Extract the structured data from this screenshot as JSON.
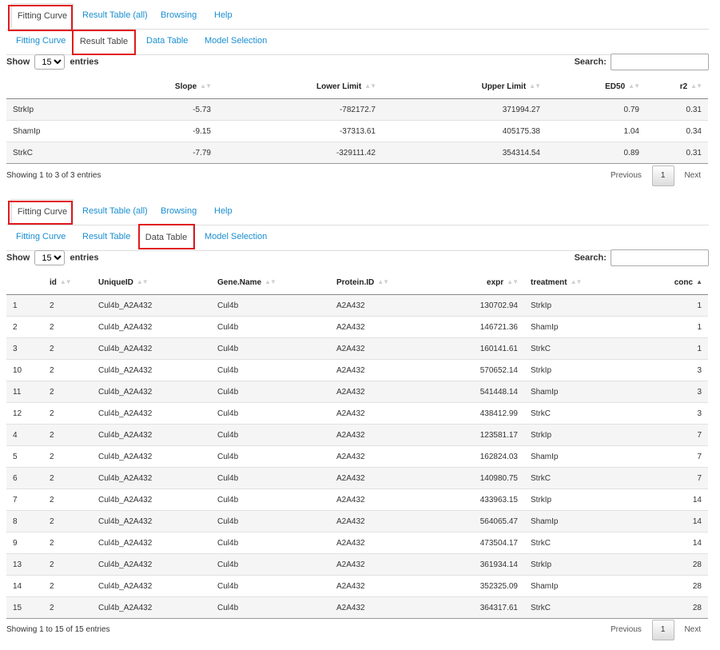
{
  "top_tabs": [
    "Fitting Curve",
    "Result Table (all)",
    "Browsing",
    "Help"
  ],
  "sub_tabs": [
    "Fitting Curve",
    "Result Table",
    "Data Table",
    "Model Selection"
  ],
  "length": {
    "show": "Show",
    "value": "15",
    "entries": "entries"
  },
  "search_label": "Search:",
  "pager": {
    "previous": "Previous",
    "page": "1",
    "next": "Next"
  },
  "result_table": {
    "columns": [
      "",
      "Slope",
      "Lower Limit",
      "Upper Limit",
      "ED50",
      "r2"
    ],
    "rows": [
      [
        "StrkIp",
        "-5.73",
        "-782172.7",
        "371994.27",
        "0.79",
        "0.31"
      ],
      [
        "ShamIp",
        "-9.15",
        "-37313.61",
        "405175.38",
        "1.04",
        "0.34"
      ],
      [
        "StrkC",
        "-7.79",
        "-329111.42",
        "354314.54",
        "0.89",
        "0.31"
      ]
    ],
    "info": "Showing 1 to 3 of 3 entries"
  },
  "data_table": {
    "columns": [
      "",
      "id",
      "UniqueID",
      "Gene.Name",
      "Protein.ID",
      "expr",
      "treatment",
      "conc"
    ],
    "rows": [
      [
        "1",
        "2",
        "Cul4b_A2A432",
        "Cul4b",
        "A2A432",
        "130702.94",
        "StrkIp",
        "1"
      ],
      [
        "2",
        "2",
        "Cul4b_A2A432",
        "Cul4b",
        "A2A432",
        "146721.36",
        "ShamIp",
        "1"
      ],
      [
        "3",
        "2",
        "Cul4b_A2A432",
        "Cul4b",
        "A2A432",
        "160141.61",
        "StrkC",
        "1"
      ],
      [
        "10",
        "2",
        "Cul4b_A2A432",
        "Cul4b",
        "A2A432",
        "570652.14",
        "StrkIp",
        "3"
      ],
      [
        "11",
        "2",
        "Cul4b_A2A432",
        "Cul4b",
        "A2A432",
        "541448.14",
        "ShamIp",
        "3"
      ],
      [
        "12",
        "2",
        "Cul4b_A2A432",
        "Cul4b",
        "A2A432",
        "438412.99",
        "StrkC",
        "3"
      ],
      [
        "4",
        "2",
        "Cul4b_A2A432",
        "Cul4b",
        "A2A432",
        "123581.17",
        "StrkIp",
        "7"
      ],
      [
        "5",
        "2",
        "Cul4b_A2A432",
        "Cul4b",
        "A2A432",
        "162824.03",
        "ShamIp",
        "7"
      ],
      [
        "6",
        "2",
        "Cul4b_A2A432",
        "Cul4b",
        "A2A432",
        "140980.75",
        "StrkC",
        "7"
      ],
      [
        "7",
        "2",
        "Cul4b_A2A432",
        "Cul4b",
        "A2A432",
        "433963.15",
        "StrkIp",
        "14"
      ],
      [
        "8",
        "2",
        "Cul4b_A2A432",
        "Cul4b",
        "A2A432",
        "564065.47",
        "ShamIp",
        "14"
      ],
      [
        "9",
        "2",
        "Cul4b_A2A432",
        "Cul4b",
        "A2A432",
        "473504.17",
        "StrkC",
        "14"
      ],
      [
        "13",
        "2",
        "Cul4b_A2A432",
        "Cul4b",
        "A2A432",
        "361934.14",
        "StrkIp",
        "28"
      ],
      [
        "14",
        "2",
        "Cul4b_A2A432",
        "Cul4b",
        "A2A432",
        "352325.09",
        "ShamIp",
        "28"
      ],
      [
        "15",
        "2",
        "Cul4b_A2A432",
        "Cul4b",
        "A2A432",
        "364317.61",
        "StrkC",
        "28"
      ]
    ],
    "info": "Showing 1 to 15 of 15 entries"
  },
  "colors": {
    "highlight": "#e0191e",
    "link": "#1a8fd1"
  },
  "icons": {
    "sort": "sort-both-icon",
    "sort_asc": "sort-asc-icon"
  }
}
